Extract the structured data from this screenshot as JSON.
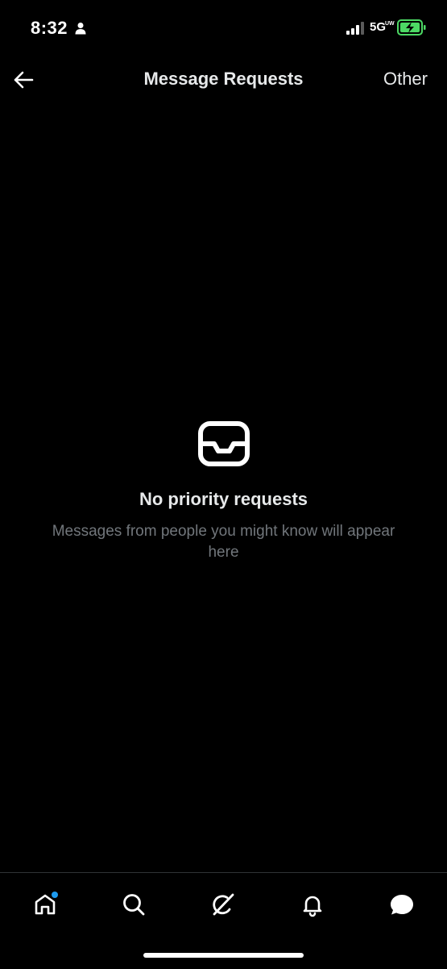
{
  "status_bar": {
    "time": "8:32",
    "network": "5G",
    "network_sub": "UW",
    "icons": [
      "person-icon",
      "signal-icon",
      "battery-charging-icon"
    ]
  },
  "header": {
    "back_icon": "arrow-left-icon",
    "title": "Message Requests",
    "other_tab": "Other"
  },
  "empty_state": {
    "icon": "inbox-icon",
    "title": "No priority requests",
    "description": "Messages from people you might know will appear here"
  },
  "bottom_nav": {
    "items": [
      {
        "icon": "home-icon",
        "has_badge": true
      },
      {
        "icon": "search-icon",
        "has_badge": false
      },
      {
        "icon": "grok-icon",
        "has_badge": false
      },
      {
        "icon": "bell-icon",
        "has_badge": false
      },
      {
        "icon": "messages-icon",
        "has_badge": false,
        "active": true
      }
    ]
  },
  "colors": {
    "background": "#000000",
    "text_primary": "#e7e9ea",
    "text_secondary": "#71767b",
    "accent": "#1d9bf0",
    "battery": "#4cd964",
    "divider": "#2f3336"
  }
}
